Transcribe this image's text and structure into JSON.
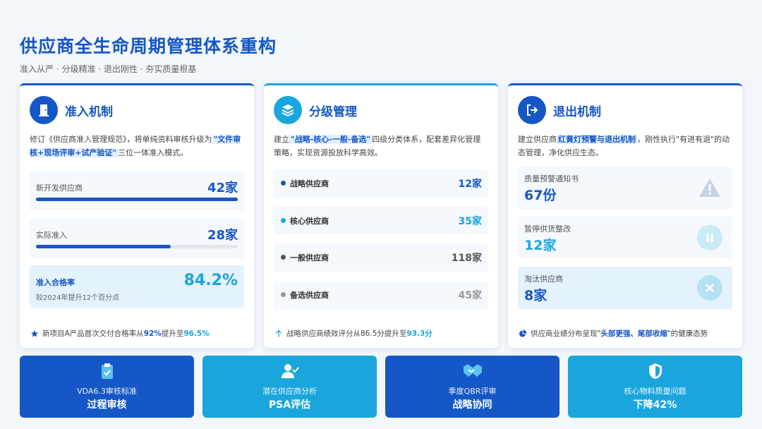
{
  "header": {
    "title": "供应商全生命周期管理体系重构",
    "subtitle": "准入从严 · 分级精准 · 退出刚性 · 夯实质量根基"
  },
  "colors": {
    "primary": "#1557c6",
    "accent": "#1aa6dc",
    "warn_icon": "#9fb3c8"
  },
  "card1": {
    "icon": "door-icon",
    "title": "准入机制",
    "desc_pre": "修订《供应商准入管理规范》，将单纯资料审核升级为",
    "desc_hl": "\"文件审核+现场评审+试产验证\"",
    "desc_post": "三位一体准入模式。",
    "stats": [
      {
        "label": "新开发供应商",
        "value": "42家",
        "progress": 1.0
      },
      {
        "label": "实际准入",
        "value": "28家",
        "progress": 0.667
      }
    ],
    "rate": {
      "label": "准入合格率",
      "value": "84.2%",
      "sub": "较2024年提升12个百分点"
    },
    "footer": {
      "icon": "star-icon",
      "pre": "新项目A产品首次交付合格率从",
      "from": "92%",
      "mid": "提升至",
      "to": "96.5%"
    }
  },
  "card2": {
    "icon": "layers-icon",
    "title": "分级管理",
    "desc_pre": "建立",
    "desc_hl": "\"战略-核心-一般-备选\"",
    "desc_post": "四级分类体系，配套差异化管理策略，实现资源投放科学高效。",
    "tiers": [
      {
        "label": "战略供应商",
        "value": "12家",
        "color": "#1557c6"
      },
      {
        "label": "核心供应商",
        "value": "35家",
        "color": "#1aa6dc"
      },
      {
        "label": "一般供应商",
        "value": "118家",
        "color": "#555555"
      },
      {
        "label": "备选供应商",
        "value": "45家",
        "color": "#999999"
      }
    ],
    "footer": {
      "icon": "arrow-up-icon",
      "pre": "战略供应商绩效评分从86.5分提升至",
      "to": "93.3分"
    }
  },
  "card3": {
    "icon": "exit-icon",
    "title": "退出机制",
    "desc_pre": "建立供应商",
    "desc_hl": "红黄灯预警与退出机制",
    "desc_post": "，刚性执行\"有进有退\"的动态管理，净化供应生态。",
    "items": [
      {
        "label": "质量预警通知书",
        "value": "67份",
        "icon": "warning-icon"
      },
      {
        "label": "暂停供货整改",
        "value": "12家",
        "icon": "pause-icon"
      },
      {
        "label": "淘汰供应商",
        "value": "8家",
        "icon": "close-icon"
      }
    ],
    "footer": {
      "icon": "pie-icon",
      "pre": "供应商业绩分布呈现\"",
      "hl": "头部更强、尾部收缩",
      "post": "\"的健康态势"
    }
  },
  "tiles": [
    {
      "icon": "clipboard-icon",
      "label": "VDA6.3审核标准",
      "value": "过程审核"
    },
    {
      "icon": "user-check-icon",
      "label": "潜在供应商分析",
      "value": "PSA评估"
    },
    {
      "icon": "handshake-icon",
      "label": "季度QBR评审",
      "value": "战略协同"
    },
    {
      "icon": "shield-icon",
      "label": "核心物料质量问题",
      "value": "下降42%"
    }
  ]
}
